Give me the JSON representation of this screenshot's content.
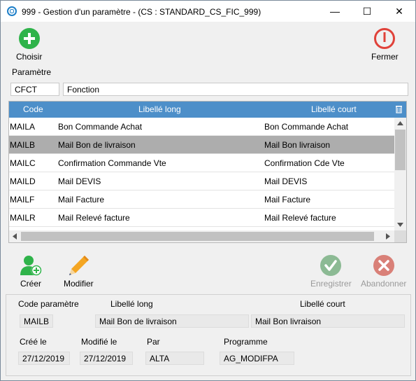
{
  "window": {
    "title": "999 - Gestion d'un paramètre - (CS : STANDARD_CS_FIC_999)",
    "minimize": "—",
    "maximize": "☐",
    "close": "✕"
  },
  "toolbar": {
    "choose_label": "Choisir",
    "close_label": "Fermer"
  },
  "parametre": {
    "section_label": "Paramètre",
    "code": "CFCT",
    "libelle": "Fonction"
  },
  "grid": {
    "columns": [
      "Code",
      "Libellé long",
      "Libellé court"
    ],
    "rows": [
      {
        "code": "MAILA",
        "long": "Bon Commande Achat",
        "short": "Bon Commande Achat"
      },
      {
        "code": "MAILB",
        "long": "Mail Bon de livraison",
        "short": "Mail Bon livraison"
      },
      {
        "code": "MAILC",
        "long": "Confirmation Commande Vte",
        "short": "Confirmation Cde Vte"
      },
      {
        "code": "MAILD",
        "long": "Mail DEVIS",
        "short": "Mail DEVIS"
      },
      {
        "code": "MAILF",
        "long": "Mail Facture",
        "short": "Mail Facture"
      },
      {
        "code": "MAILR",
        "long": "Mail Relevé facture",
        "short": "Mail Relevé facture"
      }
    ],
    "selected_index": 1
  },
  "actions": {
    "create_label": "Créer",
    "modify_label": "Modifier",
    "save_label": "Enregistrer",
    "cancel_label": "Abandonner"
  },
  "detail": {
    "code_label": "Code paramètre",
    "long_label": "Libellé long",
    "short_label": "Libellé court",
    "code_value": "MAILB",
    "long_value": "Mail Bon de livraison",
    "short_value": "Mail Bon livraison",
    "created_label": "Créé le",
    "modified_label": "Modifié le",
    "by_label": "Par",
    "program_label": "Programme",
    "created_value": "27/12/2019",
    "modified_value": "27/12/2019",
    "by_value": "ALTA",
    "program_value": "AG_MODIFPA"
  },
  "colors": {
    "header_blue": "#4d8fc9",
    "selected_row": "#adadad",
    "add_green": "#2fb34a",
    "close_red": "#e0423a",
    "disabled_gray": "#9a9a9a"
  }
}
